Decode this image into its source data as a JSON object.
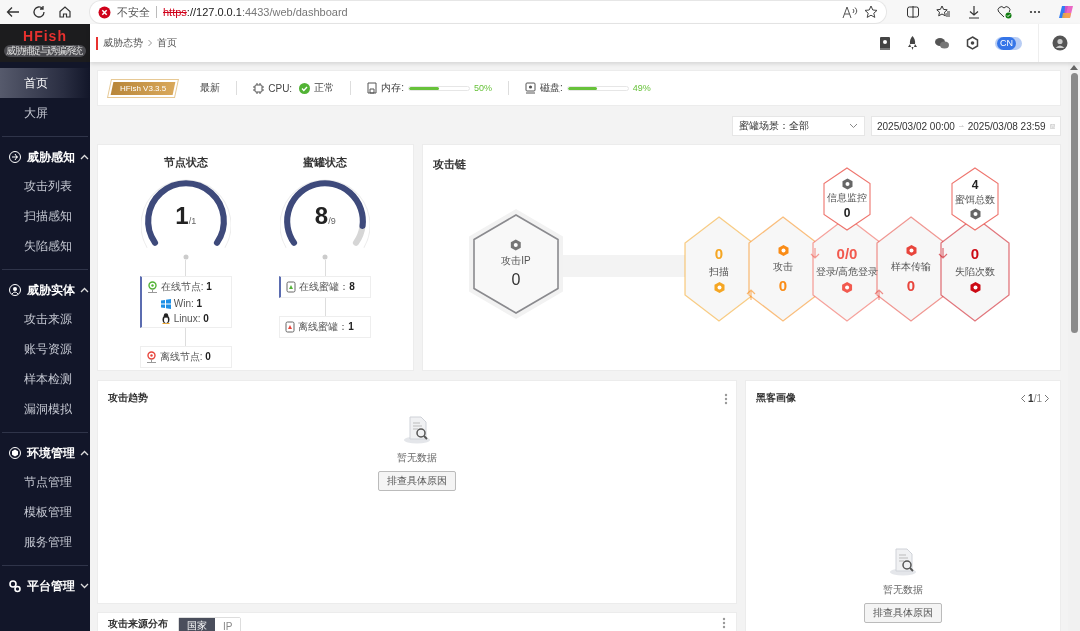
{
  "browser": {
    "security": "不安全",
    "url_scheme": "https",
    "url_host": "://127.0.0.1",
    "url_path": ":4433/web/dashboard"
  },
  "logo": {
    "title": "HFish",
    "subtitle": "威胁捕捉与诱骗系统"
  },
  "sidebar": {
    "items": [
      {
        "label": "首页",
        "selected": true
      },
      {
        "label": "大屏",
        "selected": false
      }
    ],
    "groups": [
      {
        "title": "威胁感知",
        "expanded": true,
        "items": [
          {
            "label": "攻击列表",
            "selected": false
          },
          {
            "label": "扫描感知",
            "selected": false
          },
          {
            "label": "失陷感知",
            "selected": false
          }
        ]
      },
      {
        "title": "威胁实体",
        "expanded": true,
        "items": [
          {
            "label": "攻击来源",
            "selected": false
          },
          {
            "label": "账号资源",
            "selected": false
          },
          {
            "label": "样本检测",
            "selected": false
          },
          {
            "label": "漏洞模拟",
            "selected": false
          }
        ]
      },
      {
        "title": "环境管理",
        "expanded": true,
        "items": [
          {
            "label": "节点管理",
            "selected": false
          },
          {
            "label": "模板管理",
            "selected": false
          },
          {
            "label": "服务管理",
            "selected": false
          }
        ]
      },
      {
        "title": "平台管理",
        "expanded": false
      }
    ]
  },
  "breadcrumb": [
    "威胁态势",
    "首页"
  ],
  "language_switch": {
    "label": "CN",
    "on": true
  },
  "status_bar": {
    "version": "HFish V3.3.5",
    "version_status": "最新",
    "cpu": {
      "label": "CPU:",
      "status": "正常"
    },
    "memory": {
      "label": "内存:",
      "level": 0.5,
      "reading": "50%"
    },
    "disk": {
      "label": "磁盘:",
      "level": 0.49,
      "reading": "49%"
    }
  },
  "filters": {
    "scene": {
      "label": "蜜罐场景：",
      "value": "全部"
    },
    "date_range": {
      "start": "2025/03/02 00:00",
      "end": "2025/03/08 23:59"
    }
  },
  "node_status": {
    "title": "节点状态",
    "value": "1",
    "total": "/1",
    "online": {
      "label": "在线节点:",
      "value": "1"
    },
    "os": [
      {
        "label": "Win:",
        "value": "1"
      },
      {
        "label": "Linux:",
        "value": "0"
      }
    ],
    "offline": {
      "label": "离线节点:",
      "value": "0"
    }
  },
  "honeypot_status": {
    "title": "蜜罐状态",
    "value": "8",
    "total": "/9",
    "online": {
      "label": "在线蜜罐：",
      "value": "8"
    },
    "offline": {
      "label": "离线蜜罐：",
      "value": "1"
    }
  },
  "attack_chain": {
    "title": "攻击链",
    "source": {
      "label": "攻击IP",
      "value": "0"
    },
    "stages": [
      {
        "label": "扫描",
        "value": "0",
        "color": "#f5a623"
      },
      {
        "label": "攻击",
        "value": "0",
        "color": "#fa8c16"
      },
      {
        "label": "登录/高危登录",
        "value": "0/0",
        "color": "#f25a4f"
      },
      {
        "label": "样本传输",
        "value": "0",
        "color": "#e8453c"
      },
      {
        "label": "失陷次数",
        "value": "0",
        "color": "#cc0a14"
      }
    ],
    "extras": [
      {
        "label": "信息监控",
        "value": "0"
      },
      {
        "label": "蜜饵总数",
        "value": "4"
      }
    ]
  },
  "attack_trend": {
    "title": "攻击趋势",
    "empty_text": "暂无数据",
    "button": "排查具体原因"
  },
  "hacker_profile": {
    "title": "黑客画像",
    "page": "1",
    "pages": "/1",
    "empty_text": "暂无数据",
    "button": "排查具体原因"
  },
  "attack_source": {
    "title": "攻击来源分布",
    "tabs": [
      {
        "label": "国家",
        "selected": true
      },
      {
        "label": "IP",
        "selected": false
      }
    ]
  }
}
